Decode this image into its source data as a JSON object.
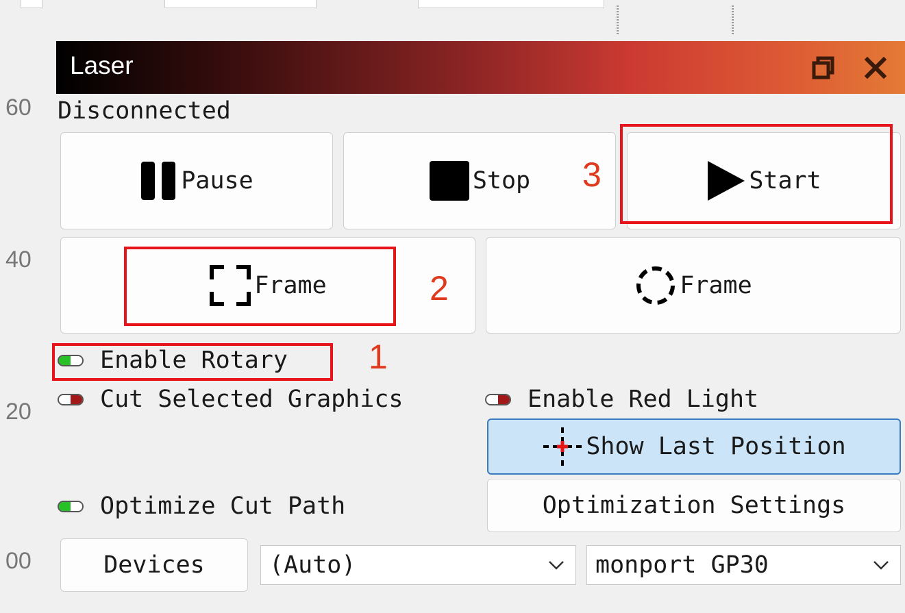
{
  "panel": {
    "title": "Laser",
    "status": "Disconnected"
  },
  "ruler": {
    "ticks": [
      "60",
      "40",
      "20",
      "00"
    ]
  },
  "buttons": {
    "pause": "Pause",
    "stop": "Stop",
    "start": "Start",
    "frame_rect": "Frame",
    "frame_circle": "Frame",
    "show_last_position": "Show Last Position",
    "optimization_settings": "Optimization Settings",
    "devices": "Devices"
  },
  "toggles": {
    "enable_rotary": {
      "label": "Enable Rotary",
      "on": true
    },
    "cut_selected_graphics": {
      "label": "Cut Selected Graphics",
      "on": false
    },
    "enable_red_light": {
      "label": "Enable Red Light",
      "on": false
    },
    "optimize_cut_path": {
      "label": "Optimize Cut Path",
      "on": true
    }
  },
  "dropdowns": {
    "port": "(Auto)",
    "device": "monport GP30"
  },
  "annotations": [
    "1",
    "2",
    "3"
  ],
  "colors": {
    "toggle_on": "#27c027",
    "toggle_off": "#a01818",
    "annotation_red": "#e8141c",
    "selected_blue": "#cce4f7"
  },
  "icons": {
    "titlebar": [
      "restore-window-icon",
      "close-icon"
    ],
    "pause": "pause-icon",
    "stop": "stop-icon",
    "start": "play-icon",
    "frame_rect": "dashed-square-icon",
    "frame_circle": "dashed-circle-icon",
    "show_last_position": "crosshair-icon",
    "dropdown": "chevron-down-icon"
  }
}
